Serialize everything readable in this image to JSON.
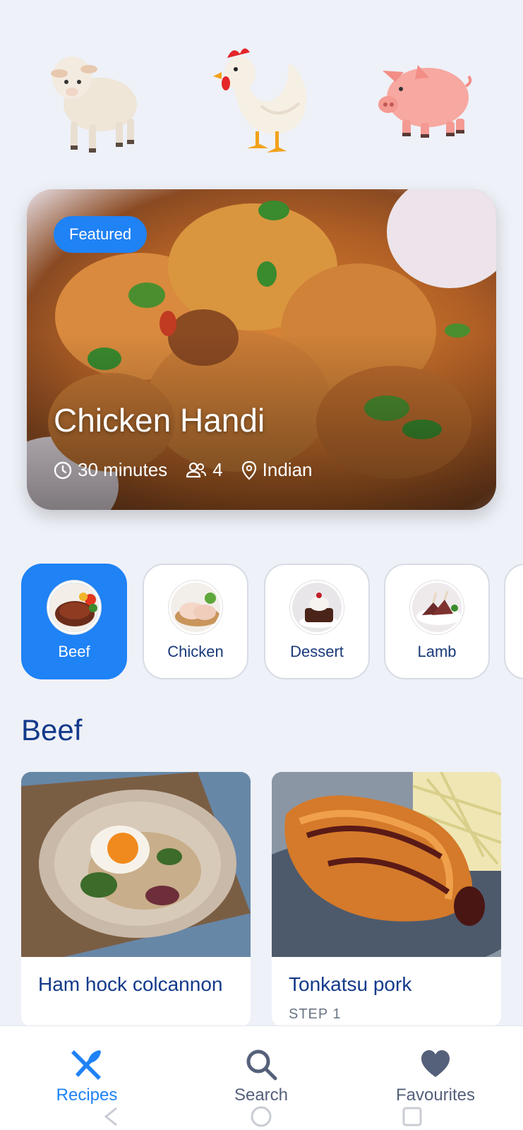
{
  "animals": [
    {
      "icon": "sheep-icon"
    },
    {
      "icon": "chicken-icon"
    },
    {
      "icon": "pig-icon"
    }
  ],
  "featured": {
    "badge": "Featured",
    "title": "Chicken Handi",
    "time": "30 minutes",
    "servings": "4",
    "cuisine": "Indian"
  },
  "categories": [
    {
      "label": "Beef",
      "active": true
    },
    {
      "label": "Chicken",
      "active": false
    },
    {
      "label": "Dessert",
      "active": false
    },
    {
      "label": "Lamb",
      "active": false
    }
  ],
  "section": {
    "title": "Beef"
  },
  "recipes": [
    {
      "title": "Ham hock colcannon",
      "subtitle": ""
    },
    {
      "title": "Tonkatsu pork",
      "subtitle": "STEP 1"
    }
  ],
  "nav": {
    "recipes": "Recipes",
    "search": "Search",
    "favourites": "Favourites"
  },
  "colors": {
    "accent": "#1f82f5",
    "heading": "#133a8a",
    "background": "#eef1f8"
  }
}
